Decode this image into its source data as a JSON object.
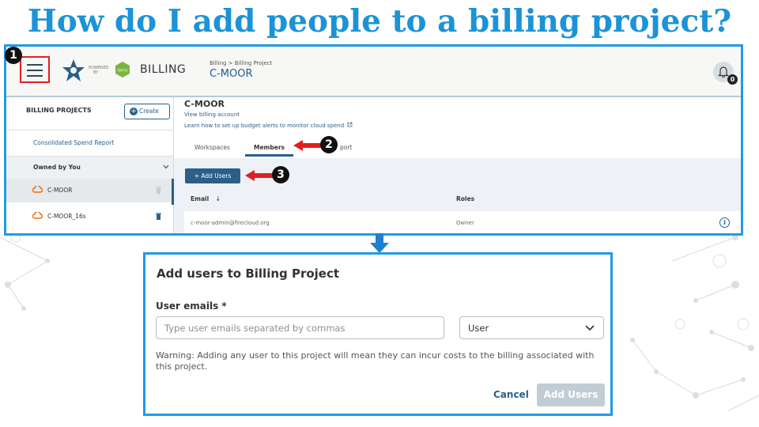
{
  "slide": {
    "title": "How do I add people to a billing project?"
  },
  "steps": [
    "1",
    "2",
    "3"
  ],
  "appbar": {
    "powered_by": [
      "POWERED",
      "BY"
    ],
    "logo_text": "terra",
    "app_name": "BILLING",
    "breadcrumb": "Billing > Billing Project",
    "project_name": "C-MOOR",
    "notification_count": "0"
  },
  "sidebar": {
    "title": "BILLING PROJECTS",
    "create_label": "Create",
    "consolidated": "Consolidated Spend Report",
    "owned_by": "Owned by You",
    "projects": [
      {
        "name": "C-MOOR",
        "selected": true
      },
      {
        "name": "C-MOOR_16s",
        "selected": false
      }
    ]
  },
  "main": {
    "title": "C-MOOR",
    "view_account": "View billing account",
    "budget_link": "Learn how to set up budget alerts to monitor cloud spend",
    "tabs": [
      "Workspaces",
      "Members",
      "Spend report"
    ],
    "tab_visible_partial": "port",
    "active_tab": "Members",
    "add_users_label": "+ Add Users",
    "columns": {
      "email": "Email",
      "roles": "Roles"
    },
    "rows": [
      {
        "email": "c-moor-admin@firecloud.org",
        "role": "Owner"
      }
    ]
  },
  "modal": {
    "title": "Add users to Billing Project",
    "emails_label": "User emails *",
    "emails_placeholder": "Type user emails separated by commas",
    "role_value": "User",
    "warning": "Warning: Adding any user to this project will mean they can incur costs to the billing associated with this project.",
    "cancel_label": "Cancel",
    "submit_label": "Add Users"
  },
  "colors": {
    "title": "#1c93d6",
    "frame": "#1f9be5",
    "brand": "#2b5f8a",
    "step_arrow": "#e02020"
  },
  "icons": [
    "hamburger-icon",
    "terra-logo-icon",
    "bell-icon",
    "plus-circle-icon",
    "chevron-down-icon",
    "google-cloud-icon",
    "trash-icon",
    "external-link-icon",
    "sort-arrow-icon",
    "info-icon",
    "red-arrow-icon",
    "down-arrow-icon"
  ]
}
